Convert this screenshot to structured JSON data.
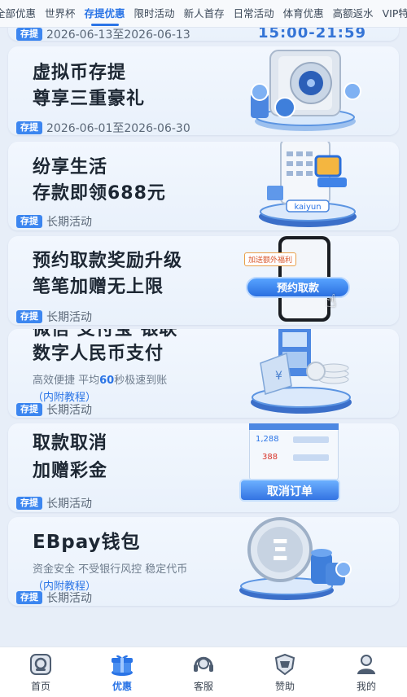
{
  "tabs": [
    "全部优惠",
    "世界杯",
    "存提优惠",
    "限时活动",
    "新人首存",
    "日常活动",
    "体育优惠",
    "高额返水",
    "VIP特权"
  ],
  "active_tab": "存提优惠",
  "cards": [
    {
      "title_lines": [],
      "subtitle": "",
      "tag": "存提",
      "tag_text": "2026-06-13至2026-06-13",
      "art_text": "15:00-21:59"
    },
    {
      "title_lines": [
        "虚拟币存提",
        "尊享三重豪礼"
      ],
      "tag": "存提",
      "tag_text": "2026-06-01至2026-06-30"
    },
    {
      "title_lines": [
        "纷享生活",
        "存款即领688元"
      ],
      "tag": "存提",
      "tag_text": "长期活动",
      "art_text": "kaiyun"
    },
    {
      "title_lines": [
        "预约取款奖励升级",
        "笔笔加赠无上限"
      ],
      "tag": "存提",
      "tag_text": "长期活动",
      "art_button": "预约取款",
      "art_badge": "加送额外福利"
    },
    {
      "title_lines": [
        "微信 支付宝 银联",
        "数字人民币支付"
      ],
      "subtitle_pre": "高效便捷  平均",
      "subtitle_hl": "60",
      "subtitle_post": "秒极速到账",
      "tutorial": "（内附教程）",
      "tag": "存提",
      "tag_text": "长期活动"
    },
    {
      "title_lines": [
        "取款取消",
        "加赠彩金"
      ],
      "tag": "存提",
      "tag_text": "长期活动",
      "art_button": "取消订单",
      "art_rows": [
        "1,288",
        "388"
      ]
    },
    {
      "title_lines": [
        "EBpay钱包"
      ],
      "subtitle": "资金安全 不受银行风控 稳定代币",
      "tutorial": "（内附教程）",
      "tag": "存提",
      "tag_text": "长期活动"
    }
  ],
  "bottom_nav": [
    {
      "label": "首页",
      "icon": "home-icon"
    },
    {
      "label": "优惠",
      "icon": "gift-icon"
    },
    {
      "label": "客服",
      "icon": "headset-icon"
    },
    {
      "label": "赞助",
      "icon": "shield-icon"
    },
    {
      "label": "我的",
      "icon": "user-icon"
    }
  ],
  "colors": {
    "accent": "#2a74e6",
    "tag_bg": "#3c86f0",
    "card_bg": "#eef4fc"
  }
}
